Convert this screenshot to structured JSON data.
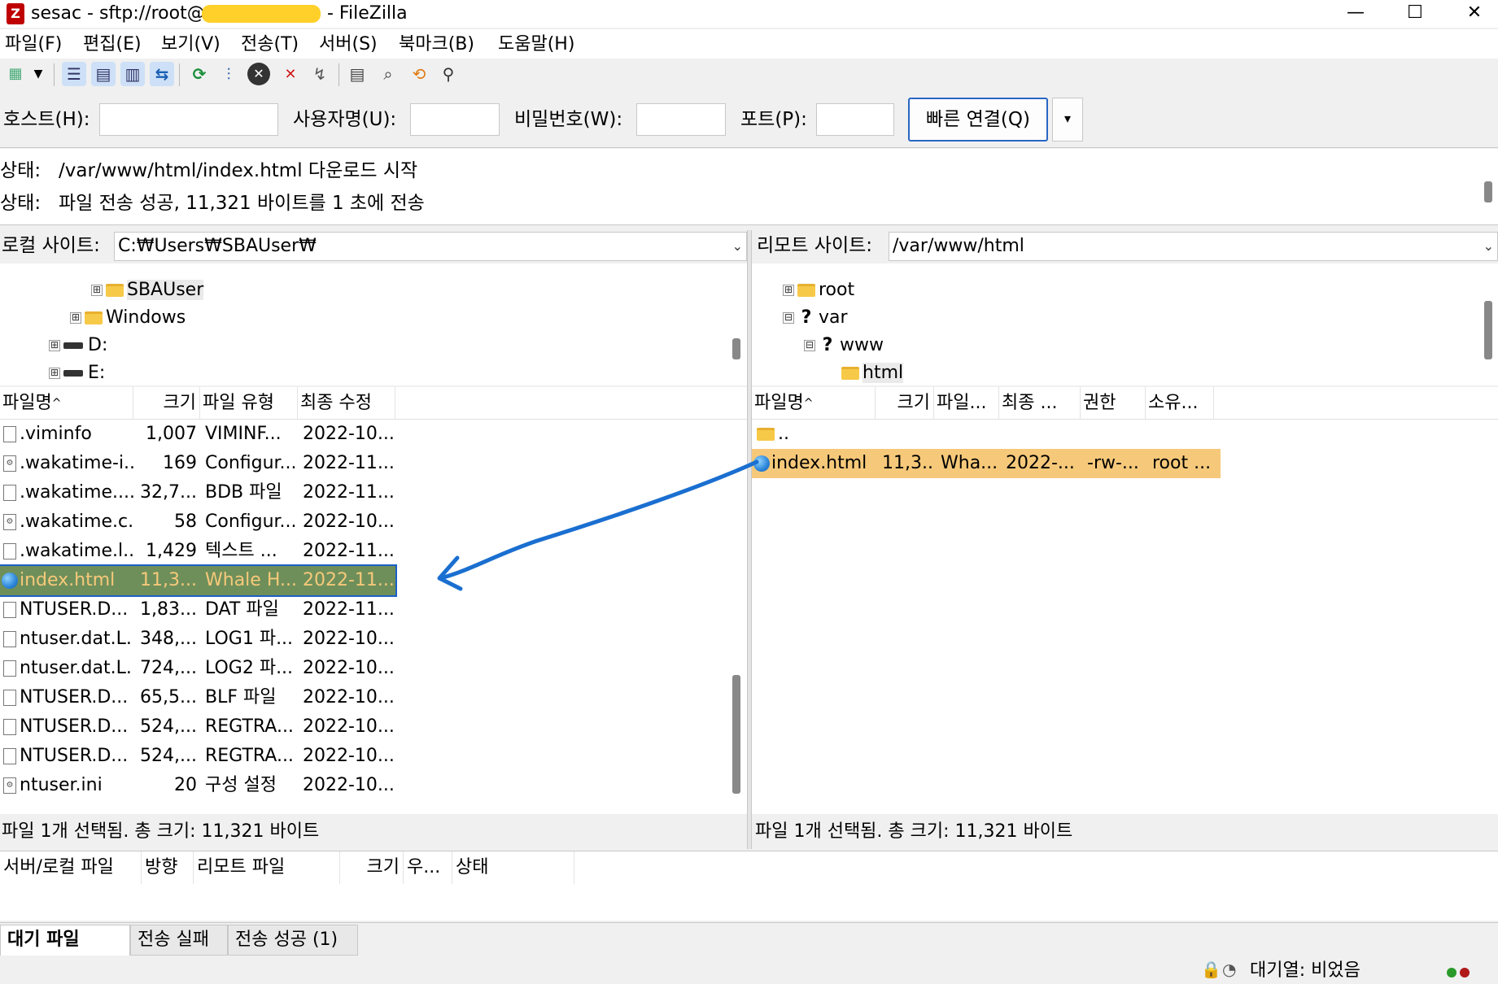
{
  "window": {
    "title_prefix": "sesac - sftp://root@",
    "title_suffix": "- FileZilla",
    "minimize": "—",
    "maximize": "☐",
    "close": "✕"
  },
  "menu": [
    "파일(F)",
    "편집(E)",
    "보기(V)",
    "전송(T)",
    "서버(S)",
    "북마크(B)",
    "도움말(H)"
  ],
  "toolbar": {
    "icons": [
      "site-manager-icon",
      "dropdown-arrow-icon",
      "toggle-log-icon",
      "toggle-local-tree-icon",
      "toggle-remote-tree-icon",
      "toggle-queue-icon",
      "refresh-icon",
      "process-queue-icon",
      "cancel-icon",
      "disconnect-icon",
      "reconnect-icon",
      "directory-listing-filter-icon",
      "compare-icon",
      "sync-browse-icon",
      "search-icon"
    ]
  },
  "quickconnect": {
    "host_label": "호스트(H):",
    "user_label": "사용자명(U):",
    "pass_label": "비밀번호(W):",
    "port_label": "포트(P):",
    "host_value": "",
    "user_value": "",
    "pass_value": "",
    "port_value": "",
    "connect_label": "빠른 연결(Q)",
    "dropdown_glyph": "▾"
  },
  "log": [
    {
      "label": "상태:",
      "text": "/var/www/html/index.html 다운로드 시작"
    },
    {
      "label": "상태:",
      "text": "파일 전송 성공, 11,321 바이트를 1 초에 전송"
    }
  ],
  "local": {
    "site_label": "로컬 사이트:",
    "path": "C:₩Users₩SBAUser₩",
    "tree": [
      {
        "name": "SBAUser",
        "icon": "folder-icon",
        "expander": "⊞"
      },
      {
        "name": "Windows",
        "icon": "folder-icon",
        "expander": "⊞"
      },
      {
        "name": "D:",
        "icon": "drive-icon",
        "expander": "⊞"
      },
      {
        "name": "E:",
        "icon": "drive-icon",
        "expander": "⊞"
      }
    ],
    "columns": [
      "파일명",
      "크기",
      "파일 유형",
      "최종 수정"
    ],
    "sort_indicator": "^",
    "files": [
      {
        "name": ".viminfo",
        "size": "1,007",
        "type": "VIMINF...",
        "modified": "2022-10...",
        "icon": "file"
      },
      {
        "name": ".wakatime-i...",
        "size": "169",
        "type": "Configur...",
        "modified": "2022-11...",
        "icon": "cfg"
      },
      {
        "name": ".wakatime....",
        "size": "32,7...",
        "type": "BDB 파일",
        "modified": "2022-11...",
        "icon": "file"
      },
      {
        "name": ".wakatime.c...",
        "size": "58",
        "type": "Configur...",
        "modified": "2022-10...",
        "icon": "cfg"
      },
      {
        "name": ".wakatime.l...",
        "size": "1,429",
        "type": "텍스트 ...",
        "modified": "2022-11...",
        "icon": "file"
      },
      {
        "name": "index.html",
        "size": "11,3...",
        "type": "Whale H...",
        "modified": "2022-11...",
        "icon": "web",
        "selected": true
      },
      {
        "name": "NTUSER.D...",
        "size": "1,83...",
        "type": "DAT 파일",
        "modified": "2022-11...",
        "icon": "file"
      },
      {
        "name": "ntuser.dat.L...",
        "size": "348,...",
        "type": "LOG1 파...",
        "modified": "2022-10...",
        "icon": "file"
      },
      {
        "name": "ntuser.dat.L...",
        "size": "724,...",
        "type": "LOG2 파...",
        "modified": "2022-10...",
        "icon": "file"
      },
      {
        "name": "NTUSER.D...",
        "size": "65,5...",
        "type": "BLF 파일",
        "modified": "2022-10...",
        "icon": "file"
      },
      {
        "name": "NTUSER.D...",
        "size": "524,...",
        "type": "REGTRA...",
        "modified": "2022-10...",
        "icon": "file"
      },
      {
        "name": "NTUSER.D...",
        "size": "524,...",
        "type": "REGTRA...",
        "modified": "2022-10...",
        "icon": "file"
      },
      {
        "name": "ntuser.ini",
        "size": "20",
        "type": "구성 설정",
        "modified": "2022-10...",
        "icon": "cfg"
      }
    ],
    "status": "파일 1개 선택됨. 총 크기: 11,321 바이트"
  },
  "remote": {
    "site_label": "리모트 사이트:",
    "path": "/var/www/html",
    "tree": [
      {
        "name": "root",
        "icon": "folder-icon",
        "expander": "⊞"
      },
      {
        "name": "var",
        "icon": "question-folder-icon",
        "expander": "⊟"
      },
      {
        "name": "www",
        "icon": "question-folder-icon",
        "expander": "⊟"
      },
      {
        "name": "html",
        "icon": "folder-icon",
        "expander": ""
      }
    ],
    "columns": [
      "파일명",
      "크기",
      "파일...",
      "최종 ...",
      "권한",
      "소유..."
    ],
    "sort_indicator": "^",
    "files": [
      {
        "name": "..",
        "size": "",
        "type": "",
        "modified": "",
        "perm": "",
        "owner": "",
        "icon": "folder"
      },
      {
        "name": "index.html",
        "size": "11,3...",
        "type": "Wha...",
        "modified": "2022-...",
        "perm": "-rw-...",
        "owner": "root ...",
        "icon": "web",
        "selected": true
      }
    ],
    "status": "파일 1개 선택됨. 총 크기: 11,321 바이트"
  },
  "queue": {
    "columns": [
      "서버/로컬 파일",
      "방향",
      "리모트 파일",
      "크기",
      "우...",
      "상태"
    ],
    "tabs": [
      "대기 파일",
      "전송 실패",
      "전송 성공 (1)"
    ],
    "footer": "대기열: 비었음"
  },
  "colors": {
    "selection": "#f6c97a",
    "focus_border": "#1a60c8",
    "annotation_arrow": "#1a6fd0",
    "redaction": "#ffd02a"
  }
}
